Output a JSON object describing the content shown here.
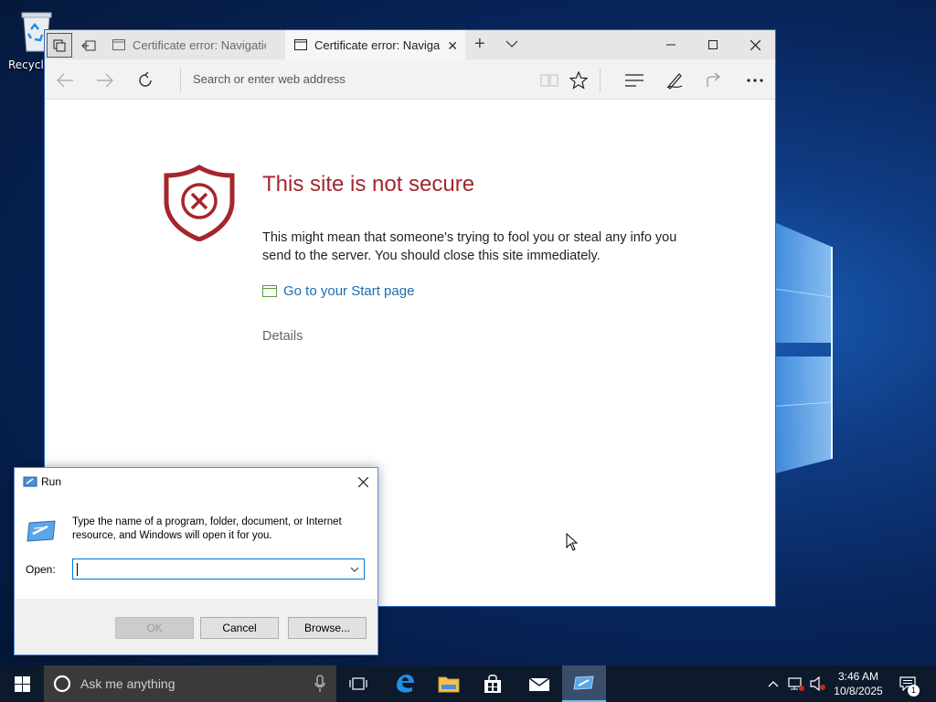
{
  "desktop": {
    "recycle_bin_label": "Recycle"
  },
  "browser": {
    "tabs": [
      {
        "label": "Certificate error: Navigation",
        "active": false
      },
      {
        "label": "Certificate error: Naviga",
        "active": true
      }
    ],
    "address_placeholder": "Search or enter web address",
    "page": {
      "title": "This site is not secure",
      "body": "This might mean that someone's trying to fool you or steal any info you send to the server. You should close this site immediately.",
      "start_link": "Go to your Start page",
      "details": "Details"
    }
  },
  "run_dialog": {
    "title": "Run",
    "description": "Type the name of a program, folder, document, or Internet resource, and Windows will open it for you.",
    "open_label": "Open:",
    "open_value": "",
    "ok_label": "OK",
    "cancel_label": "Cancel",
    "browse_label": "Browse..."
  },
  "taskbar": {
    "search_placeholder": "Ask me anything",
    "time": "3:46 AM",
    "date": "10/8/2025",
    "notification_count": "1",
    "pinned": [
      "task-view-icon",
      "edge-icon",
      "file-explorer-icon",
      "store-icon",
      "mail-icon",
      "run-icon"
    ]
  },
  "colors": {
    "error_red": "#a4262c",
    "link_blue": "#1a6db5",
    "accent": "#0078d7",
    "taskbar": "#0d1a2c"
  }
}
